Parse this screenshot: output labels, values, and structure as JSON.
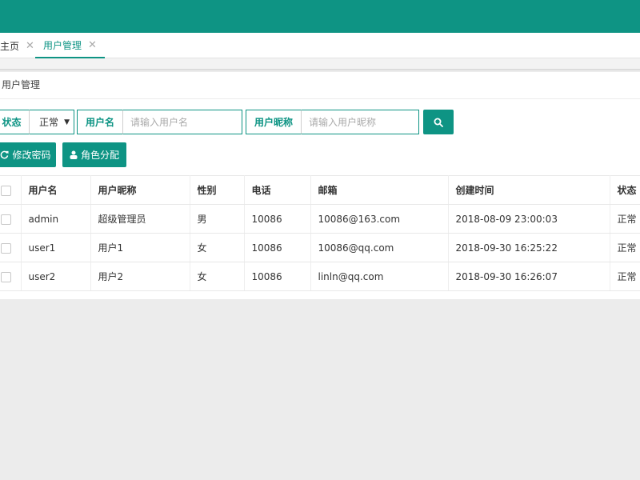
{
  "tabs": [
    {
      "label": "主页",
      "display": "主页"
    },
    {
      "label": "用户管理"
    }
  ],
  "panel": {
    "title": "用户管理"
  },
  "filters": {
    "status_label": "状态",
    "status_value": "正常",
    "username_label": "用户名",
    "username_placeholder": "请输入用户名",
    "nickname_label": "用户昵称",
    "nickname_placeholder": "请输入用户昵称"
  },
  "actions": {
    "change_password": "修改密码",
    "assign_role": "角色分配"
  },
  "table": {
    "columns": [
      "用户名",
      "用户昵称",
      "性别",
      "电话",
      "邮箱",
      "创建时间",
      "状态"
    ],
    "rows": [
      {
        "username": "admin",
        "nickname": "超级管理员",
        "gender": "男",
        "phone": "10086",
        "email": "10086@163.com",
        "created": "2018-08-09 23:00:03",
        "status": "正常"
      },
      {
        "username": "user1",
        "nickname": "用户1",
        "gender": "女",
        "phone": "10086",
        "email": "10086@qq.com",
        "created": "2018-09-30 16:25:22",
        "status": "正常"
      },
      {
        "username": "user2",
        "nickname": "用户2",
        "gender": "女",
        "phone": "10086",
        "email": "linln@qq.com",
        "created": "2018-09-30 16:26:07",
        "status": "正常"
      }
    ]
  },
  "colors": {
    "accent": "#0e9484"
  },
  "icons": {
    "search": "search-icon",
    "refresh": "refresh-icon",
    "user": "user-icon",
    "close": "close-icon"
  }
}
